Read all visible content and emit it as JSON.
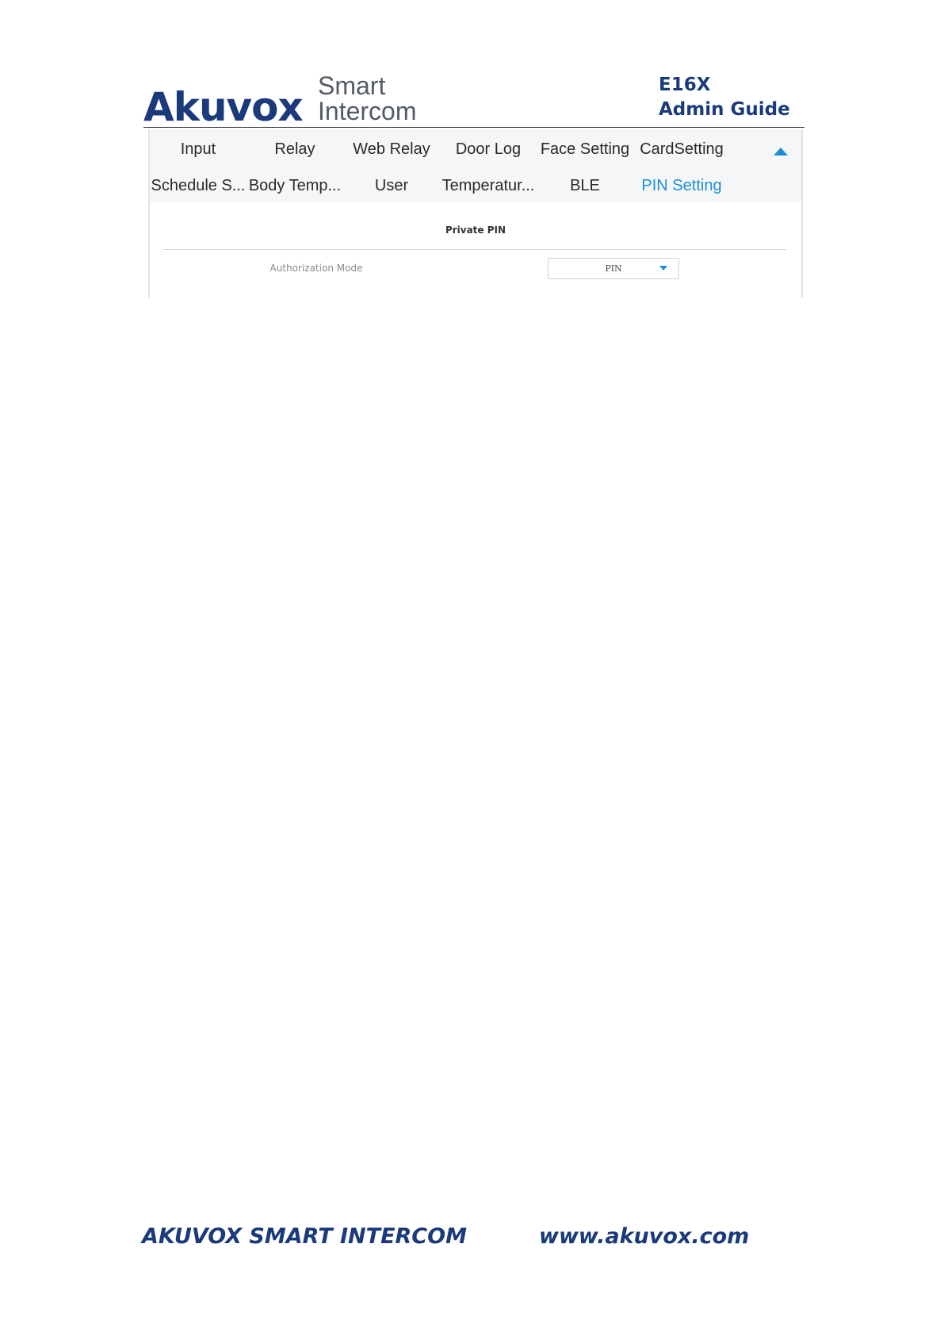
{
  "header": {
    "brand": "Akuvox",
    "brand_sub_line1": "Smart",
    "brand_sub_line2": "Intercom",
    "doc_model": "E16X",
    "doc_title": "Admin Guide"
  },
  "tabs": {
    "row1": [
      "Input",
      "Relay",
      "Web Relay",
      "Door Log",
      "Face Setting",
      "CardSetting"
    ],
    "row2": [
      "Schedule S...",
      "Body Temp...",
      "User",
      "Temperatur...",
      "BLE",
      "PIN Setting"
    ],
    "active": "PIN Setting",
    "collapse_icon": "caret-up-icon"
  },
  "section": {
    "title": "Private PIN",
    "field_label": "Authorization Mode",
    "field_value": "PIN"
  },
  "footer": {
    "left": "AKUVOX SMART INTERCOM",
    "right": "www.akuvox.com"
  },
  "colors": {
    "brand": "#1b3a7c",
    "accent": "#1a8fd6",
    "tab_bg": "#f5f6f7"
  }
}
